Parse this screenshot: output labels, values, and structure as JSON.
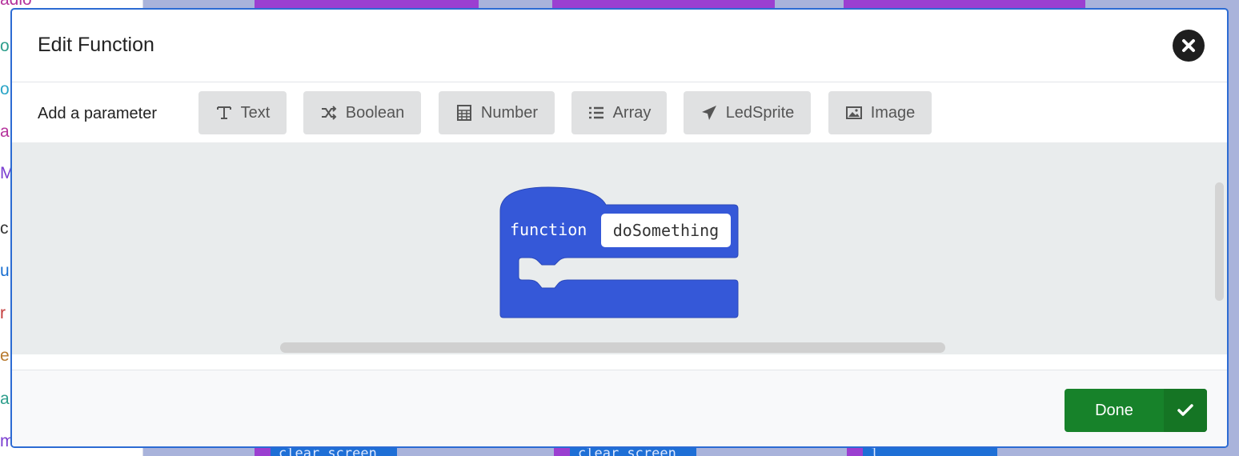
{
  "background": {
    "categories": [
      {
        "label": "adio",
        "color": "#b5339c"
      },
      {
        "label": "o",
        "color": "#2e9e8c"
      },
      {
        "label": "o",
        "color": "#2aa5c7"
      },
      {
        "label": "a",
        "color": "#b5339c"
      },
      {
        "label": "Ma",
        "color": "#7a3ed0"
      },
      {
        "label": "c",
        "color": "#333333"
      },
      {
        "label": "u",
        "color": "#1a6fd1"
      },
      {
        "label": "r",
        "color": "#c43c3c"
      },
      {
        "label": "e",
        "color": "#b87a2e"
      },
      {
        "label": "a",
        "color": "#2e9e8c"
      },
      {
        "label": "m",
        "color": "#7a3ed0"
      }
    ],
    "blocks": [
      "clear screen",
      "clear screen",
      "l"
    ]
  },
  "modal": {
    "title": "Edit Function",
    "add_parameter_label": "Add a parameter",
    "parameter_buttons": [
      {
        "label": "Text",
        "icon": "text-cursor-icon"
      },
      {
        "label": "Boolean",
        "icon": "shuffle-icon"
      },
      {
        "label": "Number",
        "icon": "calculator-icon"
      },
      {
        "label": "Array",
        "icon": "list-icon"
      },
      {
        "label": "LedSprite",
        "icon": "paper-plane-icon"
      },
      {
        "label": "Image",
        "icon": "image-icon"
      }
    ],
    "function_block": {
      "keyword": "function",
      "name": "doSomething",
      "color": "#3558d8"
    },
    "done_label": "Done",
    "colors": {
      "accent_border": "#2c6bd3",
      "done_green": "#17822a"
    }
  }
}
